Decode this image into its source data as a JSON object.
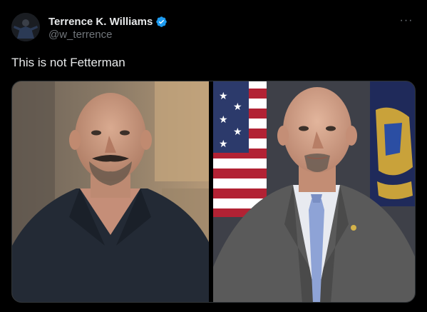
{
  "author": {
    "display_name": "Terrence K. Williams",
    "handle": "@w_terrence",
    "verified": true,
    "verified_color": "#1d9bf0"
  },
  "more_menu": {
    "icon": "more-horizontal-icon",
    "glyph": "···"
  },
  "tweet": {
    "text": "This is not Fetterman"
  },
  "media": {
    "photos": [
      {
        "subject": "bald bearded man in dark shirt"
      },
      {
        "subject": "bald bearded man in suit with flags"
      }
    ]
  },
  "colors": {
    "background": "#000000",
    "text_primary": "#e7e9ea",
    "text_secondary": "#71767b",
    "border": "#2f3336"
  }
}
